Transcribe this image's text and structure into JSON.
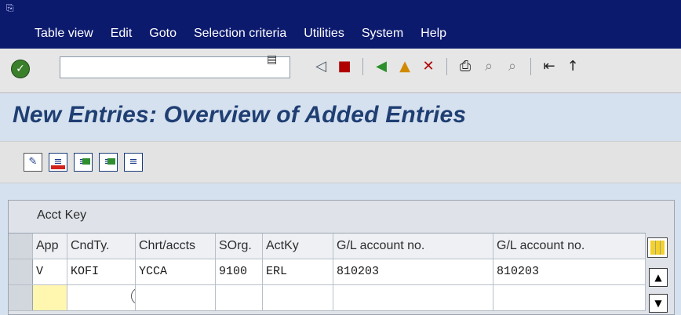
{
  "menu": {
    "items": [
      "Table view",
      "Edit",
      "Goto",
      "Selection criteria",
      "Utilities",
      "System",
      "Help"
    ]
  },
  "toolbar": {
    "command_field_value": "",
    "icons": [
      "back-icon",
      "save-icon",
      "green-back-icon",
      "exit-icon",
      "cancel-icon",
      "print-icon",
      "find-icon",
      "find-next-icon",
      "first-page-icon",
      "previous-page-icon"
    ]
  },
  "title": "New Entries: Overview of Added Entries",
  "app_toolbar": {
    "icons": [
      "change-icon",
      "delete-icon",
      "select-all-icon",
      "select-block-icon",
      "deselect-all-icon"
    ]
  },
  "table": {
    "title": "Acct Key",
    "headers": [
      "App",
      "CndTy.",
      "Chrt/accts",
      "SOrg.",
      "ActKy",
      "G/L account no.",
      "G/L account no."
    ],
    "rows": [
      [
        "V",
        "KOFI",
        "YCCA",
        "9100",
        "ERL",
        "810203",
        "810203"
      ],
      [
        "",
        "",
        "",
        "",
        "",
        "",
        ""
      ]
    ]
  },
  "colors": {
    "menu_bg": "#0c1a6e",
    "title_color": "#1f3f73",
    "accent_yellow": "#fff6b0"
  }
}
